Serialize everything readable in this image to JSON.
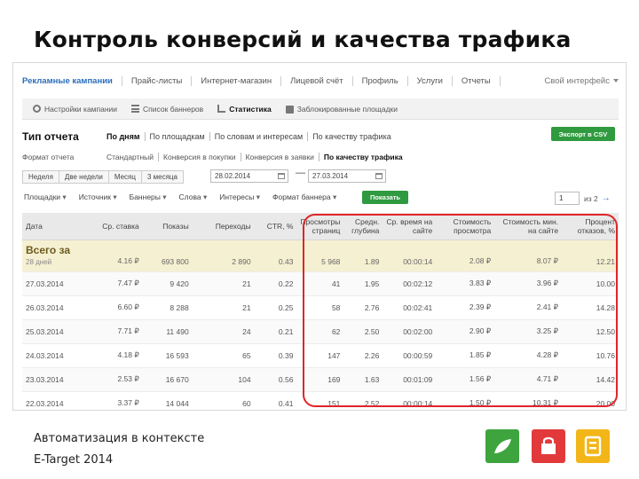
{
  "slide": {
    "title": "Контроль конверсий и качества трафика",
    "footer_line1": "Автоматизация в контексте",
    "footer_line2": "E-Target 2014"
  },
  "topnav": {
    "items": [
      "Рекламные кампании",
      "Прайс-листы",
      "Интернет-магазин",
      "Лицевой счёт",
      "Профиль",
      "Услуги",
      "Отчеты"
    ],
    "user": "Свой интерфейс"
  },
  "subnav": {
    "items": [
      "Настройки кампании",
      "Список баннеров",
      "Статистика",
      "Заблокированные площадки"
    ]
  },
  "report": {
    "label": "Тип отчета",
    "tabs": [
      "По дням",
      "По площадкам",
      "По словам и интересам",
      "По качеству трафика"
    ],
    "export_label": "Экспорт в CSV",
    "format_label": "Формат отчета",
    "format_tabs": [
      "Стандартный",
      "Конверсия в покупки",
      "Конверсия в заявки",
      "По качеству трафика"
    ]
  },
  "period": {
    "buttons": [
      "Неделя",
      "Две недели",
      "Месяц",
      "3 месяца"
    ],
    "date_from": "28.02.2014",
    "date_to": "27.03.2014",
    "dash": "—"
  },
  "filters": {
    "items": [
      "Площадки",
      "Источник",
      "Баннеры",
      "Слова",
      "Интересы",
      "Формат баннера"
    ],
    "show_label": "Показать",
    "page_value": "1",
    "page_of": "из 2",
    "next_arrow": "→"
  },
  "table": {
    "headers": [
      "Дата",
      "Ср. ставка",
      "Показы",
      "Переходы",
      "CTR, %",
      "Просмотры страниц",
      "Средн. глубина",
      "Ср. время на сайте",
      "Стоимость просмотра",
      "Стоимость мин. на сайте",
      "Процент отказов, %"
    ],
    "total_label": "Всего за",
    "total_sub": "28 дней",
    "total": [
      "4.16 ₽",
      "693 800",
      "2 890",
      "0.43",
      "5 968",
      "1.89",
      "00:00:14",
      "2.08 ₽",
      "8.07 ₽",
      "12.21"
    ],
    "rows": [
      [
        "27.03.2014",
        "7.47 ₽",
        "9 420",
        "21",
        "0.22",
        "41",
        "1.95",
        "00:02:12",
        "3.83 ₽",
        "3.96 ₽",
        "10.00"
      ],
      [
        "26.03.2014",
        "6.60 ₽",
        "8 288",
        "21",
        "0.25",
        "58",
        "2.76",
        "00:02:41",
        "2.39 ₽",
        "2.41 ₽",
        "14.28"
      ],
      [
        "25.03.2014",
        "7.71 ₽",
        "11 490",
        "24",
        "0.21",
        "62",
        "2.50",
        "00:02:00",
        "2.90 ₽",
        "3.25 ₽",
        "12.50"
      ],
      [
        "24.03.2014",
        "4.18 ₽",
        "16 593",
        "65",
        "0.39",
        "147",
        "2.26",
        "00:00:59",
        "1.85 ₽",
        "4.28 ₽",
        "10.76"
      ],
      [
        "23.03.2014",
        "2.53 ₽",
        "16 670",
        "104",
        "0.56",
        "169",
        "1.63",
        "00:01:09",
        "1.56 ₽",
        "4.71 ₽",
        "14.42"
      ],
      [
        "22.03.2014",
        "3.37 ₽",
        "14 044",
        "60",
        "0.41",
        "151",
        "2.52",
        "00:00:14",
        "1.50 ₽",
        "10.31 ₽",
        "20.00"
      ]
    ]
  },
  "colors": {
    "accent_green": "#2f9a3f",
    "highlight_red": "#e0252b",
    "total_row_bg": "#f6f0d2",
    "link_blue": "#2a6ebb"
  },
  "icons": [
    "gear-icon",
    "list-icon",
    "chart-icon",
    "lock-icon",
    "calendar-icon",
    "leaf-logo-icon",
    "bag-logo-icon",
    "register-logo-icon"
  ]
}
